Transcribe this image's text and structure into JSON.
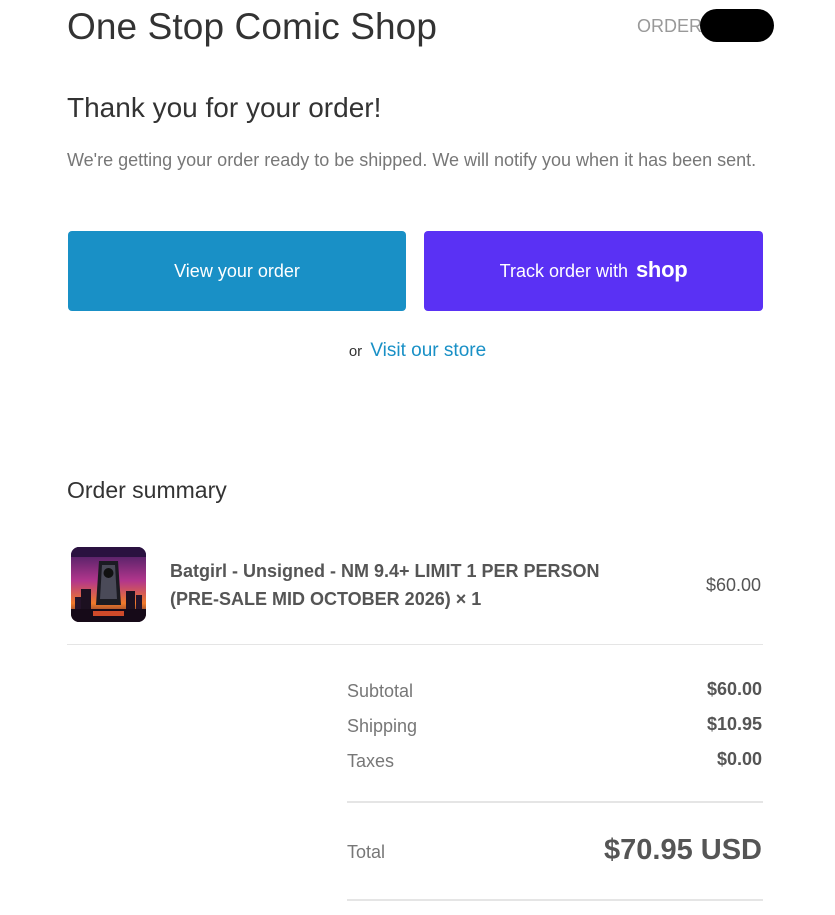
{
  "header": {
    "shop_name": "One Stop Comic Shop",
    "order_label": "ORDER"
  },
  "message": {
    "title": "Thank you for your order!",
    "body": "We're getting your order ready to be shipped. We will notify you when it has been sent."
  },
  "buttons": {
    "view_order": "View your order",
    "track_order": "Track order with",
    "track_brand": "shop"
  },
  "store_link": {
    "prefix": "or",
    "label": "Visit our store"
  },
  "summary": {
    "title": "Order summary",
    "items": [
      {
        "name": "Batgirl - Unsigned - NM 9.4+ LIMIT 1 PER PERSON (PRE-SALE MID OCTOBER 2026) × 1",
        "price": "$60.00"
      }
    ],
    "subtotal_label": "Subtotal",
    "subtotal": "$60.00",
    "shipping_label": "Shipping",
    "shipping": "$10.95",
    "taxes_label": "Taxes",
    "taxes": "$0.00",
    "total_label": "Total",
    "total": "$70.95 USD"
  },
  "colors": {
    "primary_button": "#1990c6",
    "shop_button": "#5a31f4",
    "link": "#1990c6"
  }
}
